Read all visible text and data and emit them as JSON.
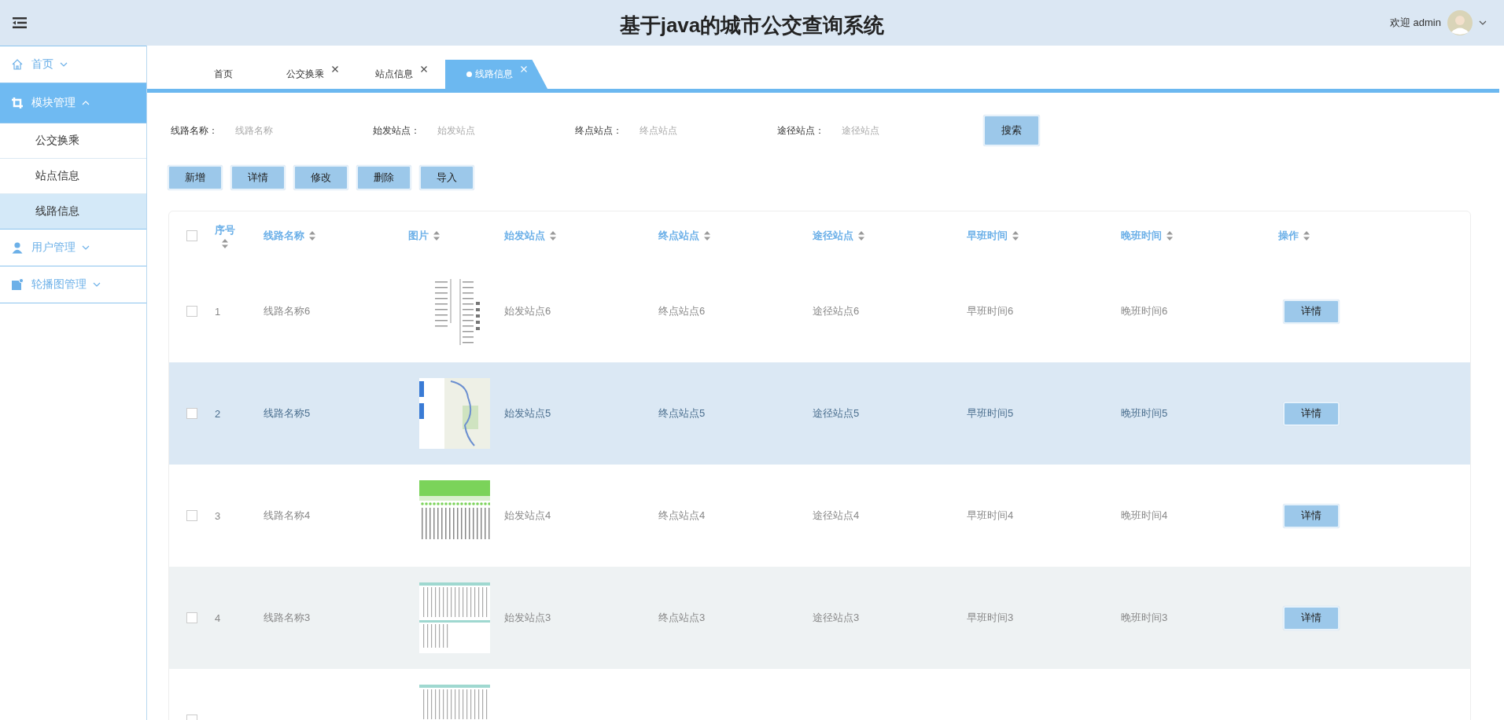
{
  "header": {
    "title": "基于java的城市公交查询系统",
    "welcome": "欢迎 admin"
  },
  "sidebar": {
    "items": [
      {
        "label": "首页",
        "kind": "home",
        "expanded": false,
        "selected": false
      },
      {
        "label": "模块管理",
        "kind": "crop",
        "expanded": true,
        "selected": true,
        "children": [
          {
            "label": "公交换乘",
            "selected": false
          },
          {
            "label": "站点信息",
            "selected": false
          },
          {
            "label": "线路信息",
            "selected": true
          }
        ]
      },
      {
        "label": "用户管理",
        "kind": "user",
        "expanded": false,
        "selected": false
      },
      {
        "label": "轮播图管理",
        "kind": "picture",
        "expanded": false,
        "selected": false
      }
    ]
  },
  "tabs": [
    {
      "label": "首页",
      "closable": false,
      "selected": false
    },
    {
      "label": "公交换乘",
      "closable": true,
      "selected": false
    },
    {
      "label": "站点信息",
      "closable": true,
      "selected": false
    },
    {
      "label": "线路信息",
      "closable": true,
      "selected": true
    }
  ],
  "search": {
    "fields": [
      {
        "label": "线路名称：",
        "placeholder": "线路名称"
      },
      {
        "label": "始发站点：",
        "placeholder": "始发站点"
      },
      {
        "label": "终点站点：",
        "placeholder": "终点站点"
      },
      {
        "label": "途径站点：",
        "placeholder": "途径站点"
      }
    ],
    "button": "搜索"
  },
  "toolbar": [
    "新增",
    "详情",
    "修改",
    "删除",
    "导入"
  ],
  "table": {
    "select_all_checked": false,
    "columns": [
      "序号",
      "线路名称",
      "图片",
      "始发站点",
      "终点站点",
      "途径站点",
      "早班时间",
      "晚班时间",
      "操作"
    ],
    "rows": [
      {
        "checked": false,
        "highlighted": false,
        "index": "1",
        "name": "线路名称6",
        "image": {
          "kind": "route-list"
        },
        "start": "始发站点6",
        "end": "终点站点6",
        "via": "途径站点6",
        "morning": "早班时间6",
        "evening": "晚班时间6",
        "action": "详情"
      },
      {
        "checked": false,
        "highlighted": true,
        "index": "2",
        "name": "线路名称5",
        "image": {
          "kind": "map"
        },
        "start": "始发站点5",
        "end": "终点站点5",
        "via": "途径站点5",
        "morning": "早班时间5",
        "evening": "晚班时间5",
        "action": "详情"
      },
      {
        "checked": false,
        "highlighted": false,
        "index": "3",
        "name": "线路名称4",
        "image": {
          "kind": "green-board"
        },
        "start": "始发站点4",
        "end": "终点站点4",
        "via": "途径站点4",
        "morning": "早班时间4",
        "evening": "晚班时间4",
        "action": "详情"
      },
      {
        "checked": false,
        "highlighted": false,
        "index": "4",
        "name": "线路名称3",
        "image": {
          "kind": "grid"
        },
        "start": "始发站点3",
        "end": "终点站点3",
        "via": "途径站点3",
        "morning": "早班时间3",
        "evening": "晚班时间3",
        "action": "详情"
      },
      {
        "checked": false,
        "highlighted": false,
        "image": {
          "kind": "grid"
        }
      }
    ]
  }
}
